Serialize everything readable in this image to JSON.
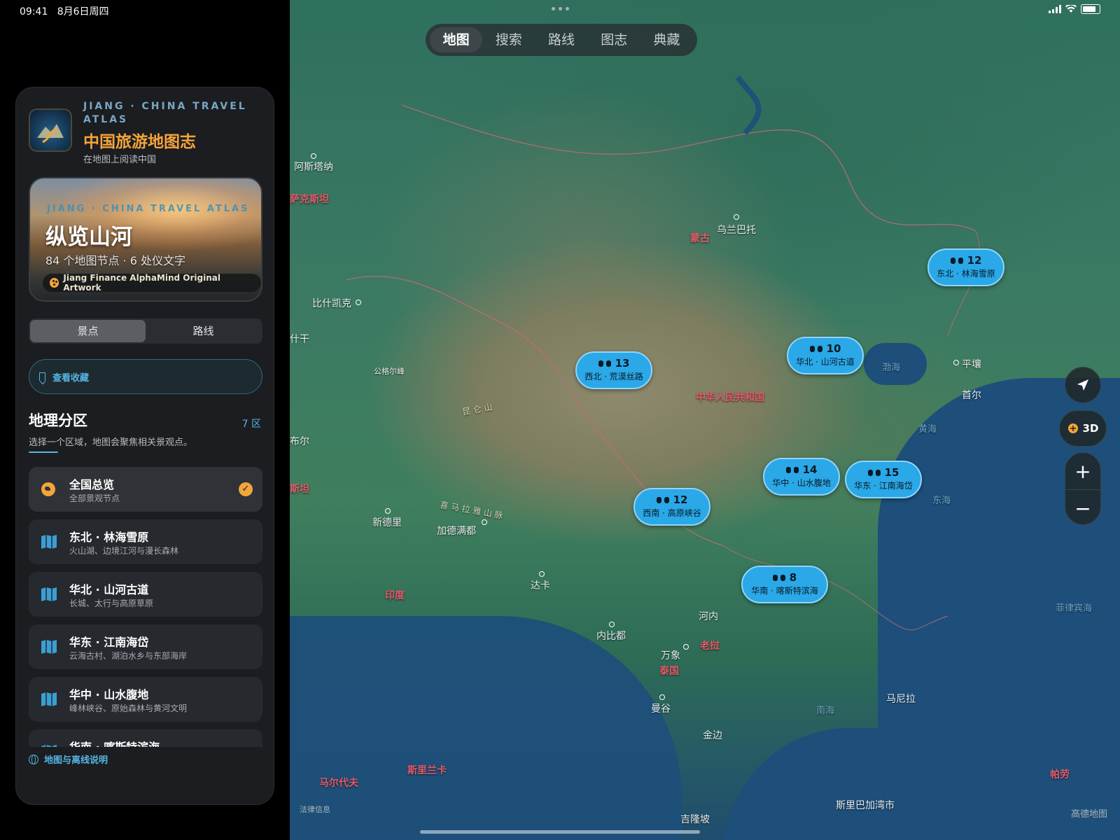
{
  "status": {
    "time": "09:41",
    "date": "8月6日周四"
  },
  "tabs": [
    "地图",
    "搜索",
    "路线",
    "图志",
    "典藏"
  ],
  "app": {
    "kicker": "JIANG · CHINA TRAVEL ATLAS",
    "title": "中国旅游地图志",
    "subtitle": "在地图上阅读中国"
  },
  "hero": {
    "kicker": "JIANG · CHINA TRAVEL ATLAS",
    "title": "纵览山河",
    "stats": "84 个地图节点 · 6 处仪文字",
    "badge": "Jiang Finance AlphaMind Original Artwork"
  },
  "segment": {
    "options": [
      "景点",
      "路线"
    ],
    "selected": "景点"
  },
  "favorites_label": "查看收藏",
  "regions_section": {
    "title": "地理分区",
    "count": "7 区",
    "subtitle": "选择一个区域，地图会聚焦相关景观点。",
    "items": [
      {
        "name": "全国总览",
        "desc": "全部景观节点",
        "selected": true,
        "icon": "globe-icon"
      },
      {
        "name": "东北 · 林海雪原",
        "desc": "火山湖、边境江河与漫长森林",
        "icon": "map-icon"
      },
      {
        "name": "华北 · 山河古道",
        "desc": "长城、太行与高原草原",
        "icon": "map-icon"
      },
      {
        "name": "华东 · 江南海岱",
        "desc": "云海古村、湖泊水乡与东部海岸",
        "icon": "map-icon"
      },
      {
        "name": "华中 · 山水腹地",
        "desc": "峰林峡谷、原始森林与黄河文明",
        "icon": "map-icon"
      },
      {
        "name": "华南 · 喀斯特滨海",
        "desc": "",
        "icon": "map-icon"
      }
    ]
  },
  "footer_link": "地图与离线说明",
  "map": {
    "clusters": [
      {
        "count": "12",
        "label": "东北 · 林海雪原"
      },
      {
        "count": "10",
        "label": "华北 · 山河古道"
      },
      {
        "count": "13",
        "label": "西北 · 荒漠丝路"
      },
      {
        "count": "14",
        "label": "华中 · 山水腹地"
      },
      {
        "count": "15",
        "label": "华东 · 江南海岱"
      },
      {
        "count": "12",
        "label": "西南 · 高原峡谷"
      },
      {
        "count": "8",
        "label": "华南 · 喀斯特滨海"
      }
    ],
    "places": {
      "astana": "阿斯塔纳",
      "kazakh": "萨克斯坦",
      "mongolia": "蒙古",
      "ulaanbaatar": "乌兰巴托",
      "bishkek": "比什凯克",
      "kashgar": "什干",
      "muztagh": "公格尔峰",
      "kunlun": "昆 仑 山",
      "china": "中华人民共和国",
      "bohai": "渤海",
      "pyongyang": "平壤",
      "seoul": "首尔",
      "yellow_sea": "黄海",
      "east_sea": "东海",
      "kabul": "布尔",
      "pakistan": "斯坦",
      "himalaya": "喜 马 拉 雅 山 脉",
      "new_delhi": "新德里",
      "kathmandu": "加德满都",
      "dhaka": "达卡",
      "india": "印度",
      "hanoi": "河内",
      "naypyidaw": "内比都",
      "vientiane": "万象",
      "laos": "老挝",
      "thailand": "泰国",
      "bangkok": "曼谷",
      "phnom_penh": "金边",
      "south_sea": "南海",
      "manila": "马尼拉",
      "philippine_sea": "菲律宾海",
      "srilanka": "斯里兰卡",
      "maldives": "马尔代夫",
      "kuala_lumpur": "吉隆坡",
      "bandar": "斯里巴加湾市",
      "palau": "帕劳"
    },
    "controls": {
      "three_d": "3D",
      "zoom_in": "+",
      "zoom_out": "−"
    },
    "legal": "法律信息",
    "brand": "高德地图"
  },
  "colors": {
    "accent": "#f3a43b",
    "link": "#56b4e4",
    "cluster": "#2aa8e8",
    "country_label": "#e25b6a"
  }
}
